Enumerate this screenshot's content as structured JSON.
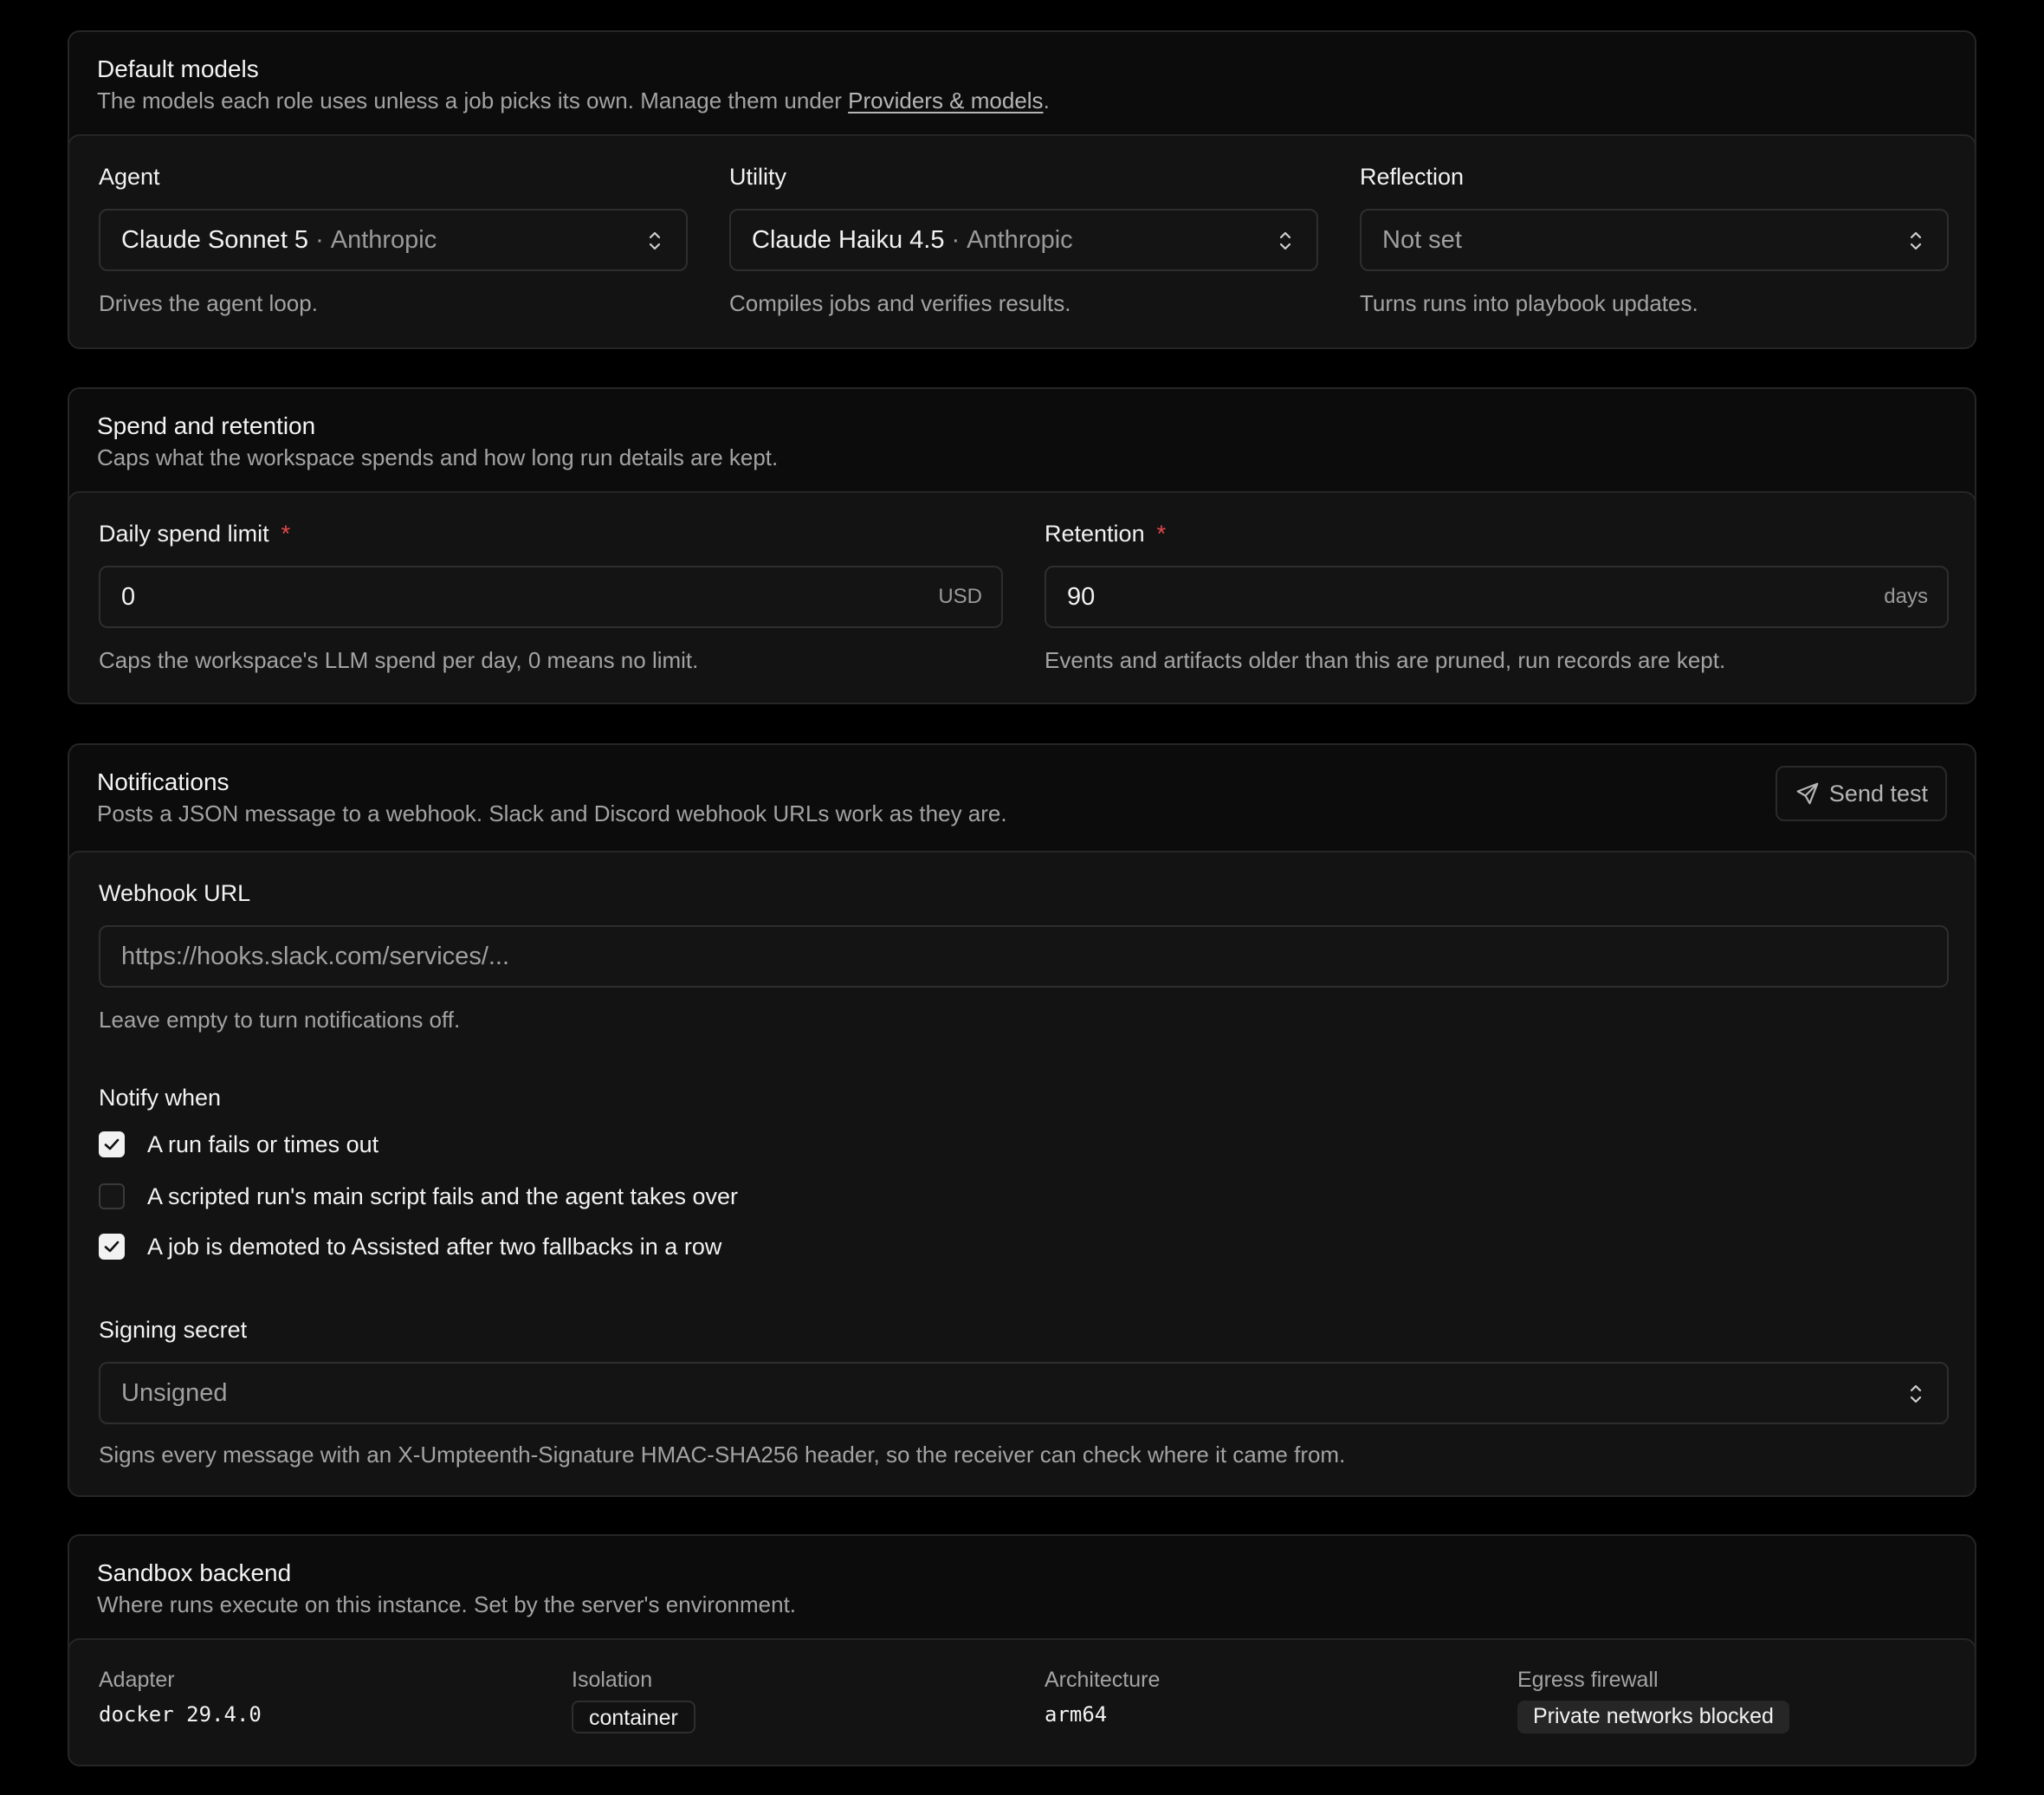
{
  "default_models": {
    "title": "Default models",
    "desc_prefix": "The models each role uses unless a job picks its own. Manage them under ",
    "desc_link": "Providers & models",
    "desc_suffix": ".",
    "agent": {
      "label": "Agent",
      "model": "Claude Sonnet 5",
      "provider": "Anthropic",
      "help": "Drives the agent loop."
    },
    "utility": {
      "label": "Utility",
      "model": "Claude Haiku 4.5",
      "provider": "Anthropic",
      "help": "Compiles jobs and verifies results."
    },
    "reflection": {
      "label": "Reflection",
      "placeholder": "Not set",
      "help": "Turns runs into playbook updates."
    }
  },
  "spend": {
    "title": "Spend and retention",
    "desc": "Caps what the workspace spends and how long run details are kept.",
    "daily_limit": {
      "label": "Daily spend limit",
      "required_mark": "*",
      "value": "0",
      "unit": "USD",
      "help": "Caps the workspace's LLM spend per day, 0 means no limit."
    },
    "retention": {
      "label": "Retention",
      "required_mark": "*",
      "value": "90",
      "unit": "days",
      "help": "Events and artifacts older than this are pruned, run records are kept."
    }
  },
  "notifications": {
    "title": "Notifications",
    "desc": "Posts a JSON message to a webhook. Slack and Discord webhook URLs work as they are.",
    "send_test_label": "Send test",
    "webhook": {
      "label": "Webhook URL",
      "placeholder": "https://hooks.slack.com/services/...",
      "help": "Leave empty to turn notifications off."
    },
    "notify_when": {
      "label": "Notify when",
      "options": [
        {
          "label": "A run fails or times out",
          "checked": true
        },
        {
          "label": "A scripted run's main script fails and the agent takes over",
          "checked": false
        },
        {
          "label": "A job is demoted to Assisted after two fallbacks in a row",
          "checked": true
        }
      ]
    },
    "signing": {
      "label": "Signing secret",
      "value": "Unsigned",
      "help": "Signs every message with an X-Umpteenth-Signature HMAC-SHA256 header, so the receiver can check where it came from."
    }
  },
  "sandbox": {
    "title": "Sandbox backend",
    "desc": "Where runs execute on this instance. Set by the server's environment.",
    "adapter": {
      "label": "Adapter",
      "value": "docker 29.4.0"
    },
    "isolation": {
      "label": "Isolation",
      "value": "container"
    },
    "architecture": {
      "label": "Architecture",
      "value": "arm64"
    },
    "egress": {
      "label": "Egress firewall",
      "value": "Private networks blocked"
    }
  },
  "colors": {
    "background": "#000000",
    "card": "#0c0c0c",
    "panel": "#131313",
    "required": "#e5484d",
    "muted_text": "#a3a3a3"
  }
}
